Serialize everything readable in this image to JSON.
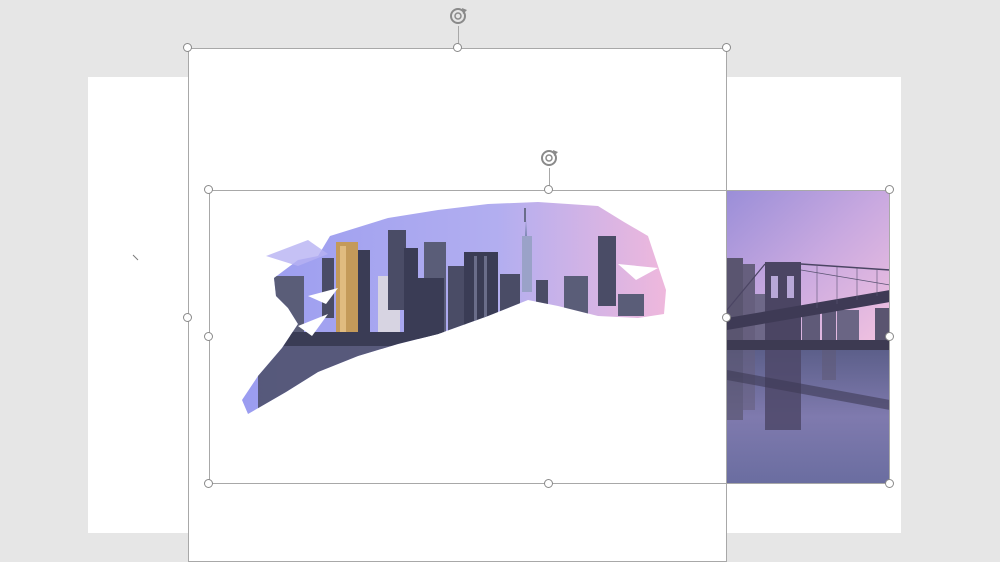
{
  "canvas": {
    "background_color": "#e6e6e6",
    "slide_color": "#ffffff",
    "selection_border_color": "#a8a8a8",
    "handle_border_color": "#8a8a8a"
  },
  "images": {
    "brush_skyline": {
      "icon": "city-skyline-brush-stroke-image",
      "sky_colors": [
        "#9a9cf0",
        "#c9b6ec",
        "#f0b8dc"
      ],
      "building_colors": [
        "#3a3c55",
        "#4a4c66",
        "#5a5d78",
        "#c49a5a"
      ]
    },
    "bridge_photo": {
      "icon": "brooklyn-bridge-photo",
      "sky_colors": [
        "#9a8ed8",
        "#c9a9e0",
        "#f2c2e0"
      ],
      "water_color": "#6a6da0"
    }
  },
  "selection": {
    "rotate_icon": "rotate-handle-icon"
  }
}
